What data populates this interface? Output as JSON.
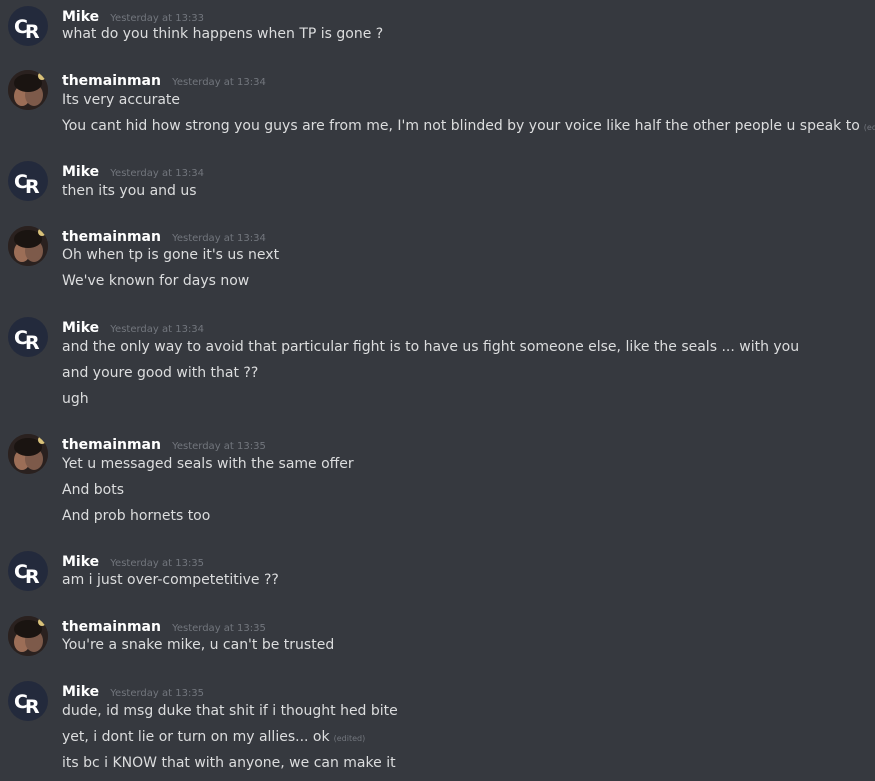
{
  "colors": {
    "background": "#36393f",
    "username": "#ffffff",
    "text": "#dcddde",
    "muted": "#72767d"
  },
  "groups": [
    {
      "author": "Mike",
      "time": "Yesterday at 13:33",
      "avatar": "cr-logo-icon",
      "messages": [
        {
          "text": "what do you think happens when TP is gone ?"
        }
      ]
    },
    {
      "author": "themainman",
      "time": "Yesterday at 13:34",
      "avatar": "user-photo",
      "messages": [
        {
          "text": "Its very accurate"
        },
        {
          "text": "You cant hid how strong you guys are from me, I'm not blinded by your voice like half the other people u speak to",
          "edited": "(edited)"
        }
      ]
    },
    {
      "author": "Mike",
      "time": "Yesterday at 13:34",
      "avatar": "cr-logo-icon",
      "messages": [
        {
          "text": "then its you and us"
        }
      ]
    },
    {
      "author": "themainman",
      "time": "Yesterday at 13:34",
      "avatar": "user-photo",
      "messages": [
        {
          "text": "Oh when tp is gone it's us next"
        },
        {
          "text": "We've known for days now"
        }
      ]
    },
    {
      "author": "Mike",
      "time": "Yesterday at 13:34",
      "avatar": "cr-logo-icon",
      "messages": [
        {
          "text": "and the only way to avoid that particular fight is to have us fight someone else, like the seals ... with you"
        },
        {
          "text": "and youre good with that ??"
        },
        {
          "text": "ugh"
        }
      ]
    },
    {
      "author": "themainman",
      "time": "Yesterday at 13:35",
      "avatar": "user-photo",
      "messages": [
        {
          "text": "Yet u messaged seals with the same offer"
        },
        {
          "text": "And bots"
        },
        {
          "text": "And prob hornets too"
        }
      ]
    },
    {
      "author": "Mike",
      "time": "Yesterday at 13:35",
      "avatar": "cr-logo-icon",
      "messages": [
        {
          "text": "am i just over-competetitive ??"
        }
      ]
    },
    {
      "author": "themainman",
      "time": "Yesterday at 13:35",
      "avatar": "user-photo",
      "messages": [
        {
          "text": "You're a snake mike, u can't be trusted"
        }
      ]
    },
    {
      "author": "Mike",
      "time": "Yesterday at 13:35",
      "avatar": "cr-logo-icon",
      "messages": [
        {
          "text": "dude, id msg duke that shit if i thought hed bite"
        },
        {
          "text": "yet, i dont lie or turn on my allies... ok",
          "edited": "(edited)"
        },
        {
          "text": "its bc i KNOW that with anyone, we can make it"
        }
      ]
    }
  ]
}
